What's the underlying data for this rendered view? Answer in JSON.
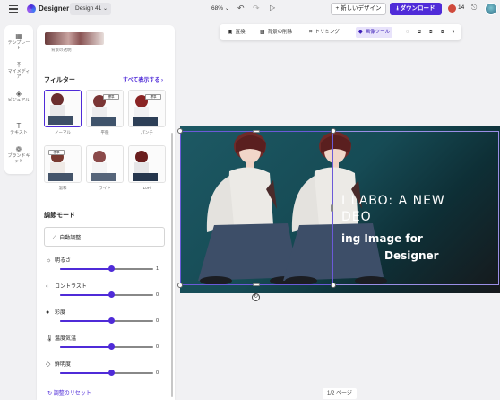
{
  "topbar": {
    "menu_icon": "hamburger-icon",
    "brand": "Designer",
    "doc_name": "Design 41",
    "zoom": "68%",
    "new_design": "新しいデザイン",
    "download": "ダウンロード",
    "credits": "14"
  },
  "rail": {
    "items": [
      {
        "icon": "template-icon",
        "label": "テンプレート"
      },
      {
        "icon": "upload-icon",
        "label": "マイメディア"
      },
      {
        "icon": "visual-icon",
        "label": "ビジュアル"
      },
      {
        "icon": "text-icon",
        "label": "テキスト"
      },
      {
        "icon": "brand-icon",
        "label": "ブランドキット"
      }
    ]
  },
  "panel": {
    "top_thumb_label": "背景の透明",
    "filter_heading": "フィルター",
    "show_all": "すべて表示する ›",
    "filters": [
      {
        "label": "ノーマル",
        "tag": "",
        "selected": true
      },
      {
        "label": "平穏",
        "tag": "標準",
        "selected": false
      },
      {
        "label": "パンチ",
        "tag": "標準",
        "selected": false
      },
      {
        "label": "温和",
        "tag": "標準",
        "selected": false
      },
      {
        "label": "ライト",
        "tag": "",
        "selected": false
      },
      {
        "label": "LoFi",
        "tag": "",
        "selected": false
      }
    ],
    "adjust_heading": "調節モード",
    "auto_adjust": "自動調整",
    "sliders": [
      {
        "label": "明るさ",
        "value": "1",
        "level": 0.55
      },
      {
        "label": "コントラスト",
        "value": "0",
        "level": 0.55
      },
      {
        "label": "彩度",
        "value": "0",
        "level": 0.55
      },
      {
        "label": "温度気温",
        "value": "0",
        "level": 0.55
      },
      {
        "label": "鮮明度",
        "value": "0",
        "level": 0.55
      }
    ],
    "reset": "↻ 調整のリセット"
  },
  "floating_toolbar": {
    "items": [
      {
        "label": "置換",
        "icon": "replace-icon"
      },
      {
        "label": "背景の削除",
        "icon": "remove-bg-icon"
      },
      {
        "label": "トリミング",
        "icon": "crop-icon"
      },
      {
        "label": "画像ツール",
        "icon": "image-tools-icon",
        "active": true
      }
    ]
  },
  "canvas": {
    "line1": "I LABO: A NEW",
    "line2": "DEO",
    "line3": "ing Image for",
    "line4": "Designer"
  },
  "page_indicator": "1/2 ページ"
}
